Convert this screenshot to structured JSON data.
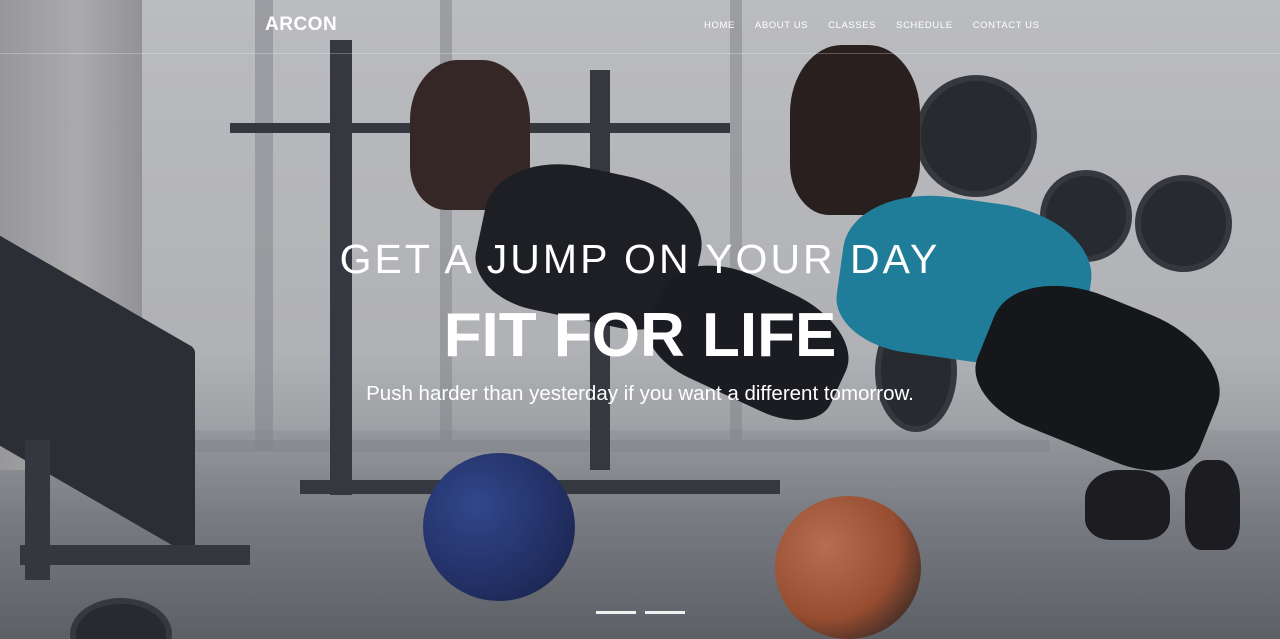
{
  "header": {
    "brand": "ARCON",
    "nav": [
      {
        "label": "HOME"
      },
      {
        "label": "ABOUT US"
      },
      {
        "label": "CLASSES"
      },
      {
        "label": "SCHEDULE"
      },
      {
        "label": "CONTACT US"
      }
    ]
  },
  "hero": {
    "kicker": "GET A JUMP ON YOUR DAY",
    "headline": "FIT FOR LIFE",
    "tagline": "Push harder than yesterday if you want a different tomorrow.",
    "slides": 2,
    "active_slide": 1
  },
  "colors": {
    "text": "#ffffff",
    "overlay": "#1e1e28"
  }
}
